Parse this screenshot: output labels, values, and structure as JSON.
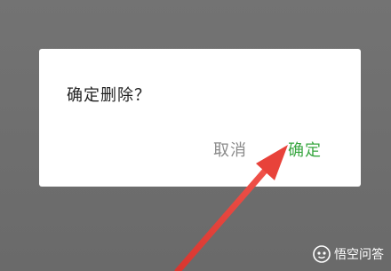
{
  "dialog": {
    "message": "确定删除？",
    "cancel_label": "取消",
    "confirm_label": "确定"
  },
  "colors": {
    "overlay": "#6e6e6e",
    "confirm": "#3aa742",
    "cancel": "#8a8a8a",
    "arrow": "#e8423a"
  },
  "watermark": {
    "text": "悟空问答",
    "icon": "wukong-logo-icon"
  },
  "annotation": {
    "icon": "red-arrow-icon"
  }
}
